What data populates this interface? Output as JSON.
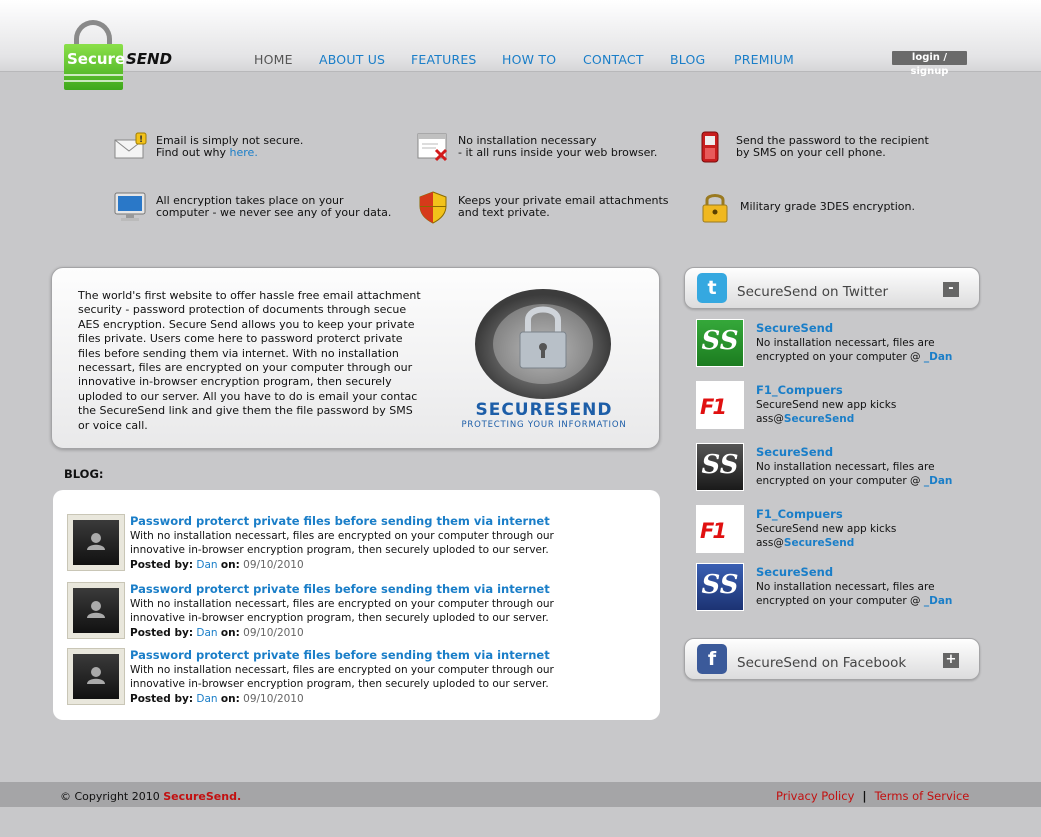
{
  "logo": {
    "secure": "Secure",
    "send": "SEND"
  },
  "nav": {
    "home": "HOME",
    "about": "ABOUT US",
    "features": "FEATURES",
    "howto": "HOW TO",
    "contact": "CONTACT",
    "blog": "BLOG",
    "premium": "PREMIUM",
    "login": "login / signup"
  },
  "features": [
    {
      "icon": "email-warning-icon",
      "line1": "Email is simply not secure.",
      "line2": "Find out why",
      "link": "here."
    },
    {
      "icon": "browser-window-icon",
      "line1": "No installation necessary",
      "line2": "- it all runs inside your web browser."
    },
    {
      "icon": "mobile-phone-icon",
      "line1": "Send the password to the recipient",
      "line2": "by SMS on your cell phone."
    },
    {
      "icon": "computer-monitor-icon",
      "line1": "All encryption takes place on your",
      "line2": "computer - we never see any of your data."
    },
    {
      "icon": "shield-icon",
      "line1": "Keeps your private email attachments",
      "line2": "and text private."
    },
    {
      "icon": "padlock-icon",
      "line1": "Military grade 3DES encryption."
    }
  ],
  "intro": {
    "text": "The world's first website to offer hassle free email attachment security - password protection of documents through secue AES encryption. Secure Send allows you to keep your private files private. Users come here to password proterct private files before sending them via internet. With no installation necessart, files are encrypted on your computer through our innovative in-browser encryption program, then securely uploded to our server. All you have to do is email your contac the SecureSend link and give them the file password by SMS or voice call.",
    "brand": "SECURESEND",
    "tagline": "PROTECTING YOUR INFORMATION"
  },
  "blog": {
    "heading": "BLOG:",
    "posted_by_label": "Posted by:",
    "on_label": "on:",
    "posts": [
      {
        "title": "Password proterct private files before sending them via internet",
        "excerpt": "With no installation necessart, files are encrypted on your computer through our innovative in-browser encryption program, then securely uploded to our server.",
        "author": "Dan",
        "date": "09/10/2010"
      },
      {
        "title": "Password proterct private files before sending them via internet",
        "excerpt": "With no installation necessart, files are encrypted on your computer through our innovative in-browser encryption program, then securely uploded to our server.",
        "author": "Dan",
        "date": "09/10/2010"
      },
      {
        "title": "Password proterct private files before sending them via internet",
        "excerpt": "With no installation necessart, files are encrypted on your computer through our innovative in-browser encryption program, then securely uploded to our server.",
        "author": "Dan",
        "date": "09/10/2010"
      }
    ]
  },
  "twitter": {
    "label": "SecureSend on Twitter",
    "toggle": "-",
    "tweets": [
      {
        "name": "SecureSend",
        "text": "No installation necessart, files are encrypted on your computer @",
        "handle": "_Dan",
        "avatar": "SS"
      },
      {
        "name": "F1_Compuers",
        "text": "SecureSend new app kicks ass@",
        "handle": "SecureSend",
        "avatar": "F1"
      },
      {
        "name": "SecureSend",
        "text": "No installation necessart, files are encrypted on your computer @",
        "handle": "_Dan",
        "avatar": "SS"
      },
      {
        "name": "F1_Compuers",
        "text": "SecureSend new app kicks ass@",
        "handle": "SecureSend",
        "avatar": "F1"
      },
      {
        "name": "SecureSend",
        "text": "No installation necessart, files are encrypted on your computer @",
        "handle": "_Dan",
        "avatar": "SS"
      }
    ]
  },
  "facebook": {
    "label": "SecureSend on Facebook",
    "toggle": "+"
  },
  "footer": {
    "copyright": "© Copyright 2010",
    "brand": "SecureSend",
    "dot": ".",
    "privacy": "Privacy Policy",
    "sep": "|",
    "terms": "Terms of Service"
  }
}
